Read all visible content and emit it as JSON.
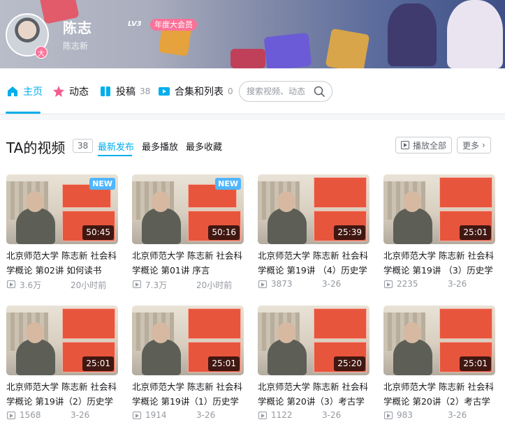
{
  "profile": {
    "name": "陈志",
    "level": "LV3",
    "vip_label": "年度大会员",
    "signature": "陈志新",
    "avatar_badge": "大"
  },
  "nav": {
    "items": [
      {
        "label": "主页",
        "count": "",
        "icon": "home-icon"
      },
      {
        "label": "动态",
        "count": "",
        "icon": "dynamic-icon"
      },
      {
        "label": "投稿",
        "count": "38",
        "icon": "upload-icon"
      },
      {
        "label": "合集和列表",
        "count": "0",
        "icon": "collection-icon"
      }
    ],
    "search_placeholder": "搜索视频、动态"
  },
  "videos_section": {
    "title": "TA的视频",
    "count": "38",
    "tabs": [
      "最新发布",
      "最多播放",
      "最多收藏"
    ],
    "play_all": "播放全部",
    "more": "更多"
  },
  "videos": [
    {
      "title_l1": "北京师范大学 陈志新 社会科",
      "title_l2": "学概论 第02讲 如何读书",
      "duration": "50:45",
      "views": "3.6万",
      "date": "20小时前",
      "new": "NEW"
    },
    {
      "title_l1": "北京师范大学 陈志新 社会科",
      "title_l2": "学概论 第01讲 序言",
      "duration": "50:16",
      "views": "7.3万",
      "date": "20小时前",
      "new": "NEW"
    },
    {
      "title_l1": "北京师范大学 陈志新 社会科",
      "title_l2": "学概论 第19讲 （4）历史学",
      "duration": "25:39",
      "views": "3873",
      "date": "3-26",
      "new": ""
    },
    {
      "title_l1": "北京师范大学 陈志新 社会科",
      "title_l2": "学概论 第19讲 （3）历史学",
      "duration": "25:01",
      "views": "2235",
      "date": "3-26",
      "new": ""
    },
    {
      "title_l1": "北京师范大学 陈志新 社会科",
      "title_l2": "学概论 第19讲（2）历史学",
      "duration": "25:01",
      "views": "1568",
      "date": "3-26",
      "new": ""
    },
    {
      "title_l1": "北京师范大学 陈志新 社会科",
      "title_l2": "学概论 第19讲（1）历史学",
      "duration": "25:01",
      "views": "1914",
      "date": "3-26",
      "new": ""
    },
    {
      "title_l1": "北京师范大学 陈志新 社会科",
      "title_l2": "学概论 第20讲（3）考古学",
      "duration": "25:20",
      "views": "1122",
      "date": "3-26",
      "new": ""
    },
    {
      "title_l1": "北京师范大学 陈志新 社会科",
      "title_l2": "学概论 第20讲（2）考古学",
      "duration": "25:01",
      "views": "983",
      "date": "3-26",
      "new": ""
    }
  ],
  "colors": {
    "accent": "#00aeec",
    "vip_pink": "#fb7299",
    "muted": "#9499a0"
  }
}
